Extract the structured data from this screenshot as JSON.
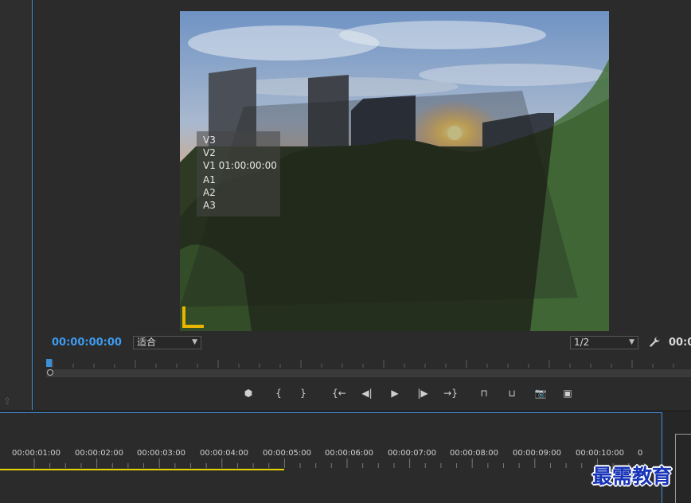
{
  "program_monitor": {
    "timecode": "00:00:00:00",
    "zoom": "适合",
    "quality": "1/2",
    "timecode_right": "00:0",
    "overlay_lines": [
      "V3",
      "V2",
      "V1 01:00:00:00",
      "A1",
      "A2",
      "A3"
    ]
  },
  "transport": [
    {
      "name": "add-marker-button",
      "icon": "marker-icon",
      "glyph": "⬢"
    },
    {
      "name": "mark-in-button",
      "icon": "mark-in-icon",
      "glyph": "{"
    },
    {
      "name": "mark-out-button",
      "icon": "mark-out-icon",
      "glyph": "}"
    },
    {
      "name": "go-to-in-button",
      "icon": "go-to-in-icon",
      "glyph": "{←"
    },
    {
      "name": "step-back-button",
      "icon": "step-back-icon",
      "glyph": "◀|"
    },
    {
      "name": "play-button",
      "icon": "play-icon",
      "glyph": "▶"
    },
    {
      "name": "step-forward-button",
      "icon": "step-forward-icon",
      "glyph": "|▶"
    },
    {
      "name": "go-to-out-button",
      "icon": "go-to-out-icon",
      "glyph": "→}"
    },
    {
      "name": "lift-button",
      "icon": "lift-icon",
      "glyph": "⊓"
    },
    {
      "name": "extract-button",
      "icon": "extract-icon",
      "glyph": "⊔"
    },
    {
      "name": "export-frame-button",
      "icon": "camera-icon",
      "glyph": "📷"
    },
    {
      "name": "comparison-view-button",
      "icon": "comparison-icon",
      "glyph": "▣"
    }
  ],
  "timeline": {
    "ruler_labels": [
      "00:00:01:00",
      "00:00:02:00",
      "00:00:03:00",
      "00:00:04:00",
      "00:00:05:00",
      "00:00:06:00",
      "00:00:07:00",
      "00:00:08:00",
      "00:00:09:00",
      "00:00:10:00",
      "0"
    ]
  },
  "watermark": "最需教育",
  "colors": {
    "accent": "#3d8fd8",
    "timecode": "#3d9bf0",
    "work_area": "#e8d400",
    "safe_margin": "#e8b400",
    "watermark": "#1733b8"
  }
}
